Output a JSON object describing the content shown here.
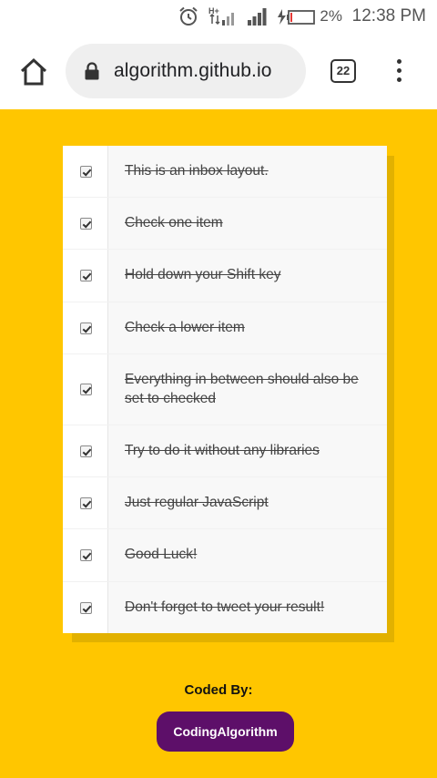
{
  "status_bar": {
    "network_label": "H+",
    "battery_percent": "2%",
    "time": "12:38 PM"
  },
  "browser": {
    "url": "algorithm.github.io",
    "tab_count": "22"
  },
  "inbox": {
    "items": [
      {
        "label": "This is an inbox layout.",
        "checked": true
      },
      {
        "label": "Check one item",
        "checked": true
      },
      {
        "label": "Hold down your Shift key",
        "checked": true
      },
      {
        "label": "Check a lower item",
        "checked": true
      },
      {
        "label": "Everything in between should also be set to checked",
        "checked": true
      },
      {
        "label": "Try to do it without any libraries",
        "checked": true
      },
      {
        "label": "Just regular JavaScript",
        "checked": true
      },
      {
        "label": "Good Luck!",
        "checked": true
      },
      {
        "label": "Don't forget to tweet your result!",
        "checked": true
      }
    ]
  },
  "footer": {
    "coded_by_label": "Coded By:",
    "author_button": "CodingAlgorithm"
  },
  "colors": {
    "page_background": "#ffc600",
    "author_button": "#5d0f69"
  }
}
